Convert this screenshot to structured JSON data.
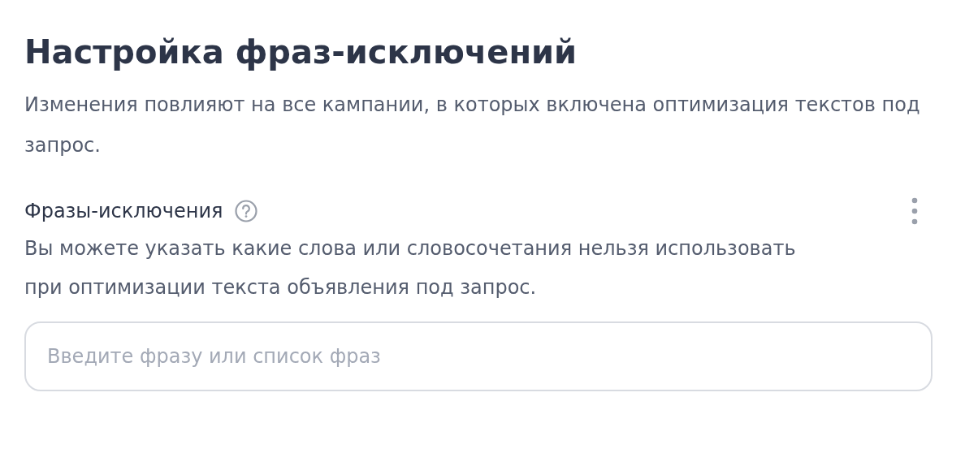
{
  "title": "Настройка фраз-исключений",
  "subtitle": "Изменения повлияют на все кампании, в которых включена оптимизация текстов под запрос.",
  "section": {
    "label": "Фразы-исключения",
    "description": "Вы можете указать какие слова или словосочетания нельзя использовать при оптимизации текста объявления под запрос."
  },
  "input": {
    "placeholder": "Введите фразу или список фраз"
  }
}
